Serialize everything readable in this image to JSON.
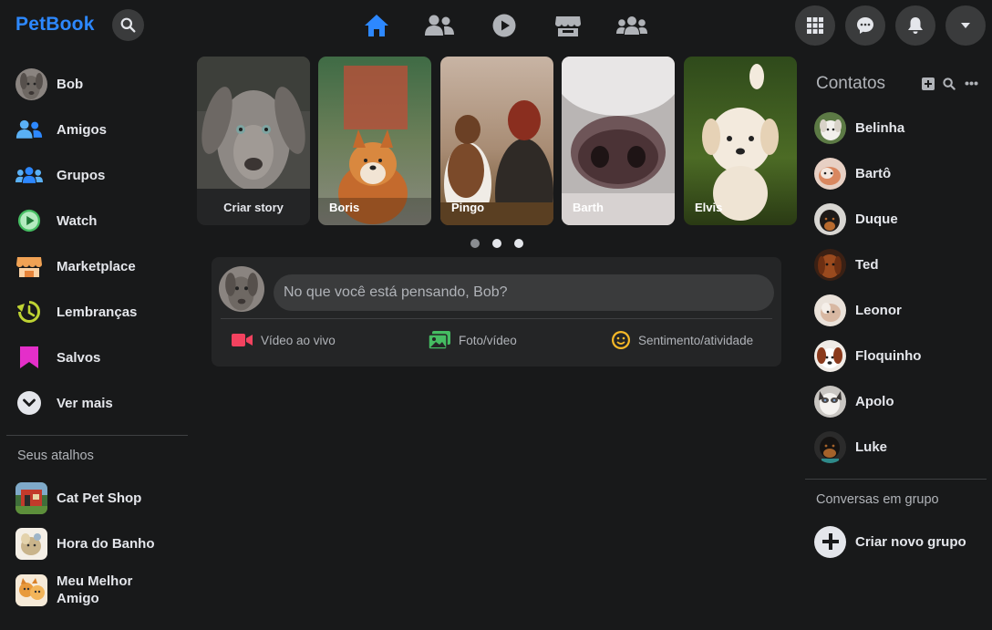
{
  "app": {
    "brand": "PetBook"
  },
  "topbar": {
    "nav": [
      "home-icon",
      "friends-icon",
      "watch-icon",
      "marketplace-icon",
      "groups-icon"
    ],
    "actions": [
      "apps-grid-icon",
      "messenger-icon",
      "notifications-icon",
      "account-menu-icon"
    ],
    "active_color": "#2d88ff"
  },
  "sidebar": {
    "items": [
      {
        "label": "Bob",
        "icon": "user-avatar"
      },
      {
        "label": "Amigos",
        "icon": "friends-icon"
      },
      {
        "label": "Grupos",
        "icon": "groups-icon"
      },
      {
        "label": "Watch",
        "icon": "watch-icon"
      },
      {
        "label": "Marketplace",
        "icon": "marketplace-icon"
      },
      {
        "label": "Lembranças",
        "icon": "memories-icon"
      },
      {
        "label": "Salvos",
        "icon": "bookmark-icon"
      },
      {
        "label": "Ver mais",
        "icon": "chevron-down-icon"
      }
    ],
    "shortcuts_title": "Seus atalhos",
    "shortcuts": [
      {
        "label": "Cat Pet Shop"
      },
      {
        "label": "Hora do Banho"
      },
      {
        "label": "Meu Melhor Amigo"
      }
    ]
  },
  "stories": [
    {
      "label": "Criar story",
      "create": true
    },
    {
      "label": "Boris"
    },
    {
      "label": "Pingo"
    },
    {
      "label": "Barth"
    },
    {
      "label": "Elvis"
    }
  ],
  "composer": {
    "placeholder": "No que você está pensando, Bob?",
    "actions": [
      {
        "label": "Vídeo ao vivo",
        "icon": "live-video-icon",
        "color": "#f3425f"
      },
      {
        "label": "Foto/vídeo",
        "icon": "photo-video-icon",
        "color": "#45bd62"
      },
      {
        "label": "Sentimento/atividade",
        "icon": "feeling-icon",
        "color": "#f7b928"
      }
    ]
  },
  "contacts": {
    "title": "Contatos",
    "items": [
      "Belinha",
      "Bartô",
      "Duque",
      "Ted",
      "Leonor",
      "Floquinho",
      "Apolo",
      "Luke"
    ]
  },
  "group_chats": {
    "title": "Conversas em grupo",
    "create_label": "Criar novo grupo"
  }
}
